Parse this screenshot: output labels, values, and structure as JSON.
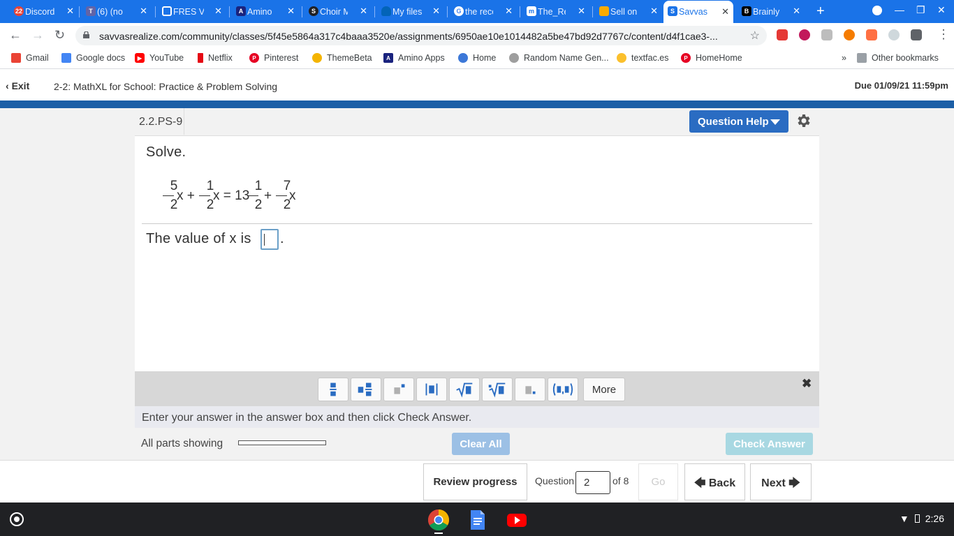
{
  "browser": {
    "tabs": [
      {
        "label": "Discord",
        "fav_color": "#ea4335",
        "fav_text": "22"
      },
      {
        "label": "(6) (no",
        "fav_color": "#6264a7",
        "fav_text": "T"
      },
      {
        "label": "FRES V",
        "fav_color": "#ffffff",
        "fav_text": ""
      },
      {
        "label": "Amino",
        "fav_color": "#1a237e",
        "fav_text": "A"
      },
      {
        "label": "Choir M",
        "fav_color": "#202124",
        "fav_text": "S"
      },
      {
        "label": "My files",
        "fav_color": "#0364b8",
        "fav_text": ""
      },
      {
        "label": "the reco",
        "fav_color": "#ffffff",
        "fav_text": "G"
      },
      {
        "label": "The_Re",
        "fav_color": "#ffffff",
        "fav_text": "m"
      },
      {
        "label": "Sell on",
        "fav_color": "#f9ab00",
        "fav_text": ""
      },
      {
        "label": "Savvas",
        "fav_color": "#1a73e8",
        "fav_text": "S"
      },
      {
        "label": "Brainly",
        "fav_color": "#000000",
        "fav_text": "B"
      }
    ],
    "active_tab_index": 9,
    "url": "savvasrealize.com/community/classes/5f45e5864a317c4baaa3520e/assignments/6950ae10e1014482a5be47bd92d7767c/content/d4f1cae3-...",
    "bookmarks": [
      {
        "label": "Gmail",
        "color": "#ea4335"
      },
      {
        "label": "Google docs",
        "color": "#4285f4"
      },
      {
        "label": "YouTube",
        "color": "#ff0000"
      },
      {
        "label": "Netflix",
        "color": "#e50914"
      },
      {
        "label": "Pinterest",
        "color": "#e60023"
      },
      {
        "label": "ThemeBeta",
        "color": "#f4b400"
      },
      {
        "label": "Amino Apps",
        "color": "#1a237e"
      },
      {
        "label": "Home",
        "color": "#3c78d8"
      },
      {
        "label": "Random Name Gen...",
        "color": "#9e9e9e"
      },
      {
        "label": "textfac.es",
        "color": "#fbc02d"
      },
      {
        "label": "HomeHome",
        "color": "#e60023"
      }
    ],
    "overflow_label": "»",
    "other_bookmarks": "Other bookmarks"
  },
  "app": {
    "exit_label": "Exit",
    "assignment_title": "2-2: MathXL for School: Practice & Problem Solving",
    "due": "Due 01/09/21 11:59pm"
  },
  "question": {
    "id": "2.2.PS-9",
    "help_label": "Question Help",
    "instruction": "Solve.",
    "equation": {
      "f1_num": "5",
      "f1_den": "2",
      "t1": "x +",
      "f2_num": "1",
      "f2_den": "2",
      "t2": "x = 13",
      "f3_num": "1",
      "f3_den": "2",
      "t3": "+",
      "f4_num": "7",
      "f4_den": "2",
      "t4": "x"
    },
    "answer_prefix": "The value of x is",
    "answer_value": "",
    "answer_suffix": "."
  },
  "palette": {
    "buttons": [
      "fraction-icon",
      "mixed-number-icon",
      "exponent-icon",
      "absolute-value-icon",
      "square-root-icon",
      "nth-root-icon",
      "decimal-icon",
      "ordered-pair-icon"
    ],
    "glyphs": [
      "▪",
      "▪▪",
      "▪˙",
      "|▪|",
      "√▪",
      "ⁿ√▪",
      "▪.",
      "(▪,▪)"
    ],
    "more_label": "More",
    "close_glyph": "✖"
  },
  "footer_area": {
    "instructions": "Enter your answer in the answer box and then click Check Answer.",
    "all_parts": "All parts showing",
    "progress_fraction": 0.0,
    "clear_all": "Clear All",
    "check_answer": "Check Answer"
  },
  "nav": {
    "review_progress": "Review progress",
    "question_label": "Question",
    "question_number": "2",
    "of_label": "of 8",
    "go_label": "Go",
    "back_label": "Back",
    "next_label": "Next"
  },
  "shelf": {
    "time": "2:26",
    "apps": [
      "chrome-icon",
      "docs-icon",
      "youtube-icon"
    ]
  },
  "colors": {
    "brand_blue": "#1c5fa6",
    "help_button": "#2a6cc2",
    "chrome_blue": "#1a73e8"
  }
}
